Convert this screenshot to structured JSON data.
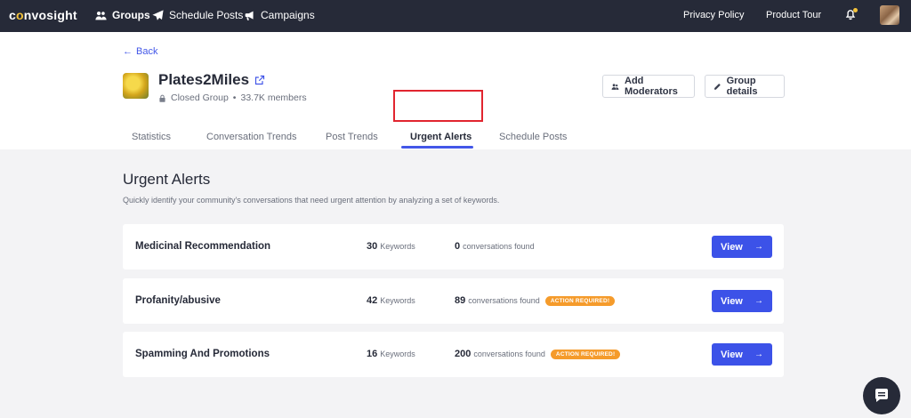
{
  "nav": {
    "logo": "convosight",
    "groups": "Groups",
    "schedule_posts": "Schedule Posts",
    "campaigns": "Campaigns",
    "privacy_policy": "Privacy Policy",
    "product_tour": "Product Tour"
  },
  "header": {
    "back": "Back",
    "group_name": "Plates2Miles",
    "group_type": "Closed Group",
    "separator": "•",
    "members": "33.7K members",
    "add_moderators": "Add Moderators",
    "group_details": "Group details"
  },
  "tabs": [
    {
      "label": "Statistics"
    },
    {
      "label": "Conversation Trends"
    },
    {
      "label": "Post Trends"
    },
    {
      "label": "Urgent Alerts"
    },
    {
      "label": "Schedule Posts"
    }
  ],
  "main": {
    "title": "Urgent Alerts",
    "description": "Quickly identify your community's conversations that need urgent attention by analyzing a set of keywords.",
    "keywords_label": "Keywords",
    "conversations_label": "conversations found",
    "view_label": "View",
    "alerts": [
      {
        "name": "Medicinal Recommendation",
        "keywords": "30",
        "conversations": "0",
        "badge": ""
      },
      {
        "name": "Profanity/abusive",
        "keywords": "42",
        "conversations": "89",
        "badge": "ACTION REQUIRED!"
      },
      {
        "name": "Spamming And Promotions",
        "keywords": "16",
        "conversations": "200",
        "badge": "ACTION REQUIRED!"
      }
    ]
  },
  "colors": {
    "nav_bg": "#262a38",
    "accent": "#3c52e8",
    "badge": "#f59b2b",
    "highlight": "#e1252f"
  }
}
